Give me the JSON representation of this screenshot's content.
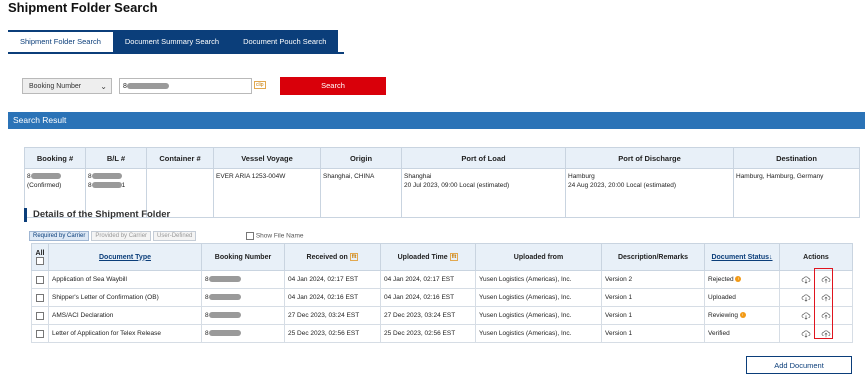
{
  "page": {
    "title": "Shipment Folder Search"
  },
  "tabs": [
    "Shipment Folder Search",
    "Document Summary Search",
    "Document Pouch Search"
  ],
  "search": {
    "type_value": "Booking Number",
    "input_prefix": "8",
    "button_label": "Search"
  },
  "result_bar": "Search Result",
  "result_table": {
    "headers": [
      "Booking #",
      "B/L #",
      "Container #",
      "Vessel Voyage",
      "Origin",
      "Port of Load",
      "Port of Discharge",
      "Destination"
    ],
    "row": {
      "booking_prefix": "8",
      "booking_status": "(Confirmed)",
      "bl_prefix_1": "8",
      "bl_prefix_2": "8",
      "bl_suffix_2": "1",
      "container": "",
      "vessel": "EVER ARIA 1253-004W",
      "origin": "Shanghai, CHINA",
      "pol_city": "Shanghai",
      "pol_time": "20 Jul 2023, 09:00 Local (estimated)",
      "pod_city": "Hamburg",
      "pod_time": "24 Aug 2023, 20:00 Local (estimated)",
      "destination": "Hamburg, Hamburg, Germany"
    }
  },
  "details": {
    "title": "Details of the Shipment Folder",
    "subtabs": [
      "Required by Carrier",
      "Provided by Carrier",
      "User-Defined"
    ],
    "show_file_name": "Show File Name",
    "headers": {
      "all": "All",
      "doc_type": "Document Type",
      "booking": "Booking Number",
      "received": "Received on",
      "uploaded_time": "Uploaded Time",
      "uploaded_from": "Uploaded from",
      "desc": "Description/Remarks",
      "status": "Document Status↓",
      "actions": "Actions"
    },
    "rows": [
      {
        "doc_type": "Application of Sea Waybill",
        "booking": "8",
        "received": "04 Jan 2024, 02:17 EST",
        "uploaded": "04 Jan 2024, 02:17 EST",
        "from": "Yusen Logistics (Americas), Inc.",
        "desc": "Version 2",
        "status": "Rejected"
      },
      {
        "doc_type": "Shipper's Letter of Confirmation (OB)",
        "booking": "8",
        "received": "04 Jan 2024, 02:16 EST",
        "uploaded": "04 Jan 2024, 02:16 EST",
        "from": "Yusen Logistics (Americas), Inc.",
        "desc": "Version 1",
        "status": "Uploaded"
      },
      {
        "doc_type": "AMS/ACI Declaration",
        "booking": "8",
        "received": "27 Dec 2023, 03:24 EST",
        "uploaded": "27 Dec 2023, 03:24 EST",
        "from": "Yusen Logistics (Americas), Inc.",
        "desc": "Version 1",
        "status": "Reviewing"
      },
      {
        "doc_type": "Letter of Application for Telex Release",
        "booking": "8",
        "received": "25 Dec 2023, 02:56 EST",
        "uploaded": "25 Dec 2023, 02:56 EST",
        "from": "Yusen Logistics (Americas), Inc.",
        "desc": "Version 1",
        "status": "Verified"
      }
    ],
    "add_button": "Add Document"
  },
  "icons": {
    "clip": "clip-icon",
    "download": "cloud-download-icon",
    "upload": "cloud-upload-icon",
    "warning": "warning-icon"
  },
  "colors": {
    "brand": "#0b3e7a",
    "bar": "#2b73b7",
    "search": "#d9000a",
    "highlight": "#e0141e"
  }
}
